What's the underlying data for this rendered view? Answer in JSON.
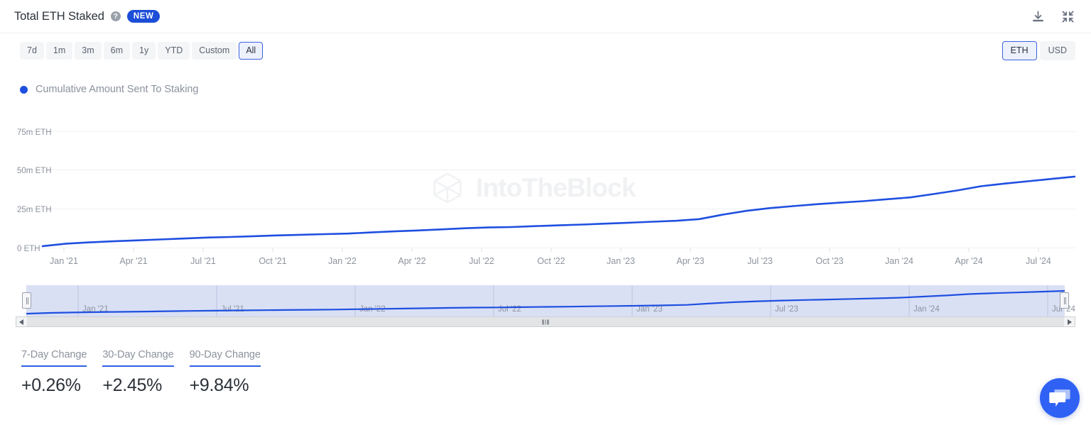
{
  "header": {
    "title": "Total ETH Staked",
    "help_icon": "help-circle-icon",
    "badge": "NEW",
    "download_icon": "download-icon",
    "collapse_icon": "collapse-icon"
  },
  "controls": {
    "ranges": [
      {
        "label": "7d",
        "active": false
      },
      {
        "label": "1m",
        "active": false
      },
      {
        "label": "3m",
        "active": false
      },
      {
        "label": "6m",
        "active": false
      },
      {
        "label": "1y",
        "active": false
      },
      {
        "label": "YTD",
        "active": false
      },
      {
        "label": "Custom",
        "active": false
      },
      {
        "label": "All",
        "active": true
      }
    ],
    "units": [
      {
        "label": "ETH",
        "active": true
      },
      {
        "label": "USD",
        "active": false
      }
    ]
  },
  "legend": {
    "items": [
      {
        "label": "Cumulative Amount Sent To Staking",
        "color": "#1f4fe0"
      }
    ]
  },
  "watermark": {
    "text": "IntoTheBlock",
    "logo": "intotheblock-cube-logo"
  },
  "stats": [
    {
      "label": "7-Day Change",
      "value": "+0.26%"
    },
    {
      "label": "30-Day Change",
      "value": "+2.45%"
    },
    {
      "label": "90-Day Change",
      "value": "+9.84%"
    }
  ],
  "navigator": {
    "xlabels": [
      "Jan '21",
      "Jul '21",
      "Jan '22",
      "Jul '22",
      "Jan '23",
      "Jul '23",
      "Jan '24",
      "Jul '24"
    ],
    "selection_start_pct": 1.0,
    "selection_end_pct": 99.0
  },
  "colors": {
    "series": "#1f4fe0",
    "accent": "#2f5fe3",
    "badge": "#1d4ed8",
    "grid": "#f0f1f3",
    "axis_text": "#8d939d",
    "navigator_fill": "#ccd6f0"
  },
  "chart_data": {
    "type": "line",
    "title": "Total ETH Staked",
    "xlabel": "",
    "ylabel": "",
    "unit": "ETH",
    "grid": true,
    "legend_position": "top-left",
    "ylim": [
      0,
      85000000
    ],
    "yticks": [
      0,
      25000000,
      50000000,
      75000000
    ],
    "ytick_labels": [
      "0 ETH",
      "25m ETH",
      "50m ETH",
      "75m ETH"
    ],
    "xticks": [
      "Jan '21",
      "Apr '21",
      "Jul '21",
      "Oct '21",
      "Jan '22",
      "Apr '22",
      "Jul '22",
      "Oct '22",
      "Jan '23",
      "Apr '23",
      "Jul '23",
      "Oct '23",
      "Jan '24",
      "Apr '24",
      "Jul '24"
    ],
    "series": [
      {
        "name": "Cumulative Amount Sent To Staking",
        "color": "#1f4fe0",
        "x": [
          "Dec '20",
          "Jan '21",
          "Feb '21",
          "Mar '21",
          "Apr '21",
          "May '21",
          "Jun '21",
          "Jul '21",
          "Aug '21",
          "Sep '21",
          "Oct '21",
          "Nov '21",
          "Dec '21",
          "Jan '22",
          "Feb '22",
          "Mar '22",
          "Apr '22",
          "May '22",
          "Jun '22",
          "Jul '22",
          "Aug '22",
          "Sep '22",
          "Oct '22",
          "Nov '22",
          "Dec '22",
          "Jan '23",
          "Feb '23",
          "Mar '23",
          "Apr '23",
          "May '23",
          "Jun '23",
          "Jul '23",
          "Aug '23",
          "Sep '23",
          "Oct '23",
          "Nov '23",
          "Dec '23",
          "Jan '24",
          "Feb '24",
          "Mar '24",
          "Apr '24",
          "May '24",
          "Jun '24",
          "Jul '24",
          "Aug '24"
        ],
        "values": [
          1200000,
          2800000,
          3600000,
          4300000,
          4900000,
          5500000,
          6100000,
          6700000,
          7100000,
          7600000,
          8100000,
          8500000,
          8900000,
          9300000,
          10000000,
          10700000,
          11300000,
          12000000,
          12700000,
          13200000,
          13500000,
          14100000,
          14600000,
          15100000,
          15700000,
          16300000,
          16900000,
          17500000,
          18600000,
          21500000,
          23900000,
          25700000,
          27000000,
          28200000,
          29200000,
          30200000,
          31400000,
          32600000,
          34800000,
          37100000,
          39800000,
          41500000,
          43000000,
          44500000,
          46000000
        ]
      }
    ]
  }
}
